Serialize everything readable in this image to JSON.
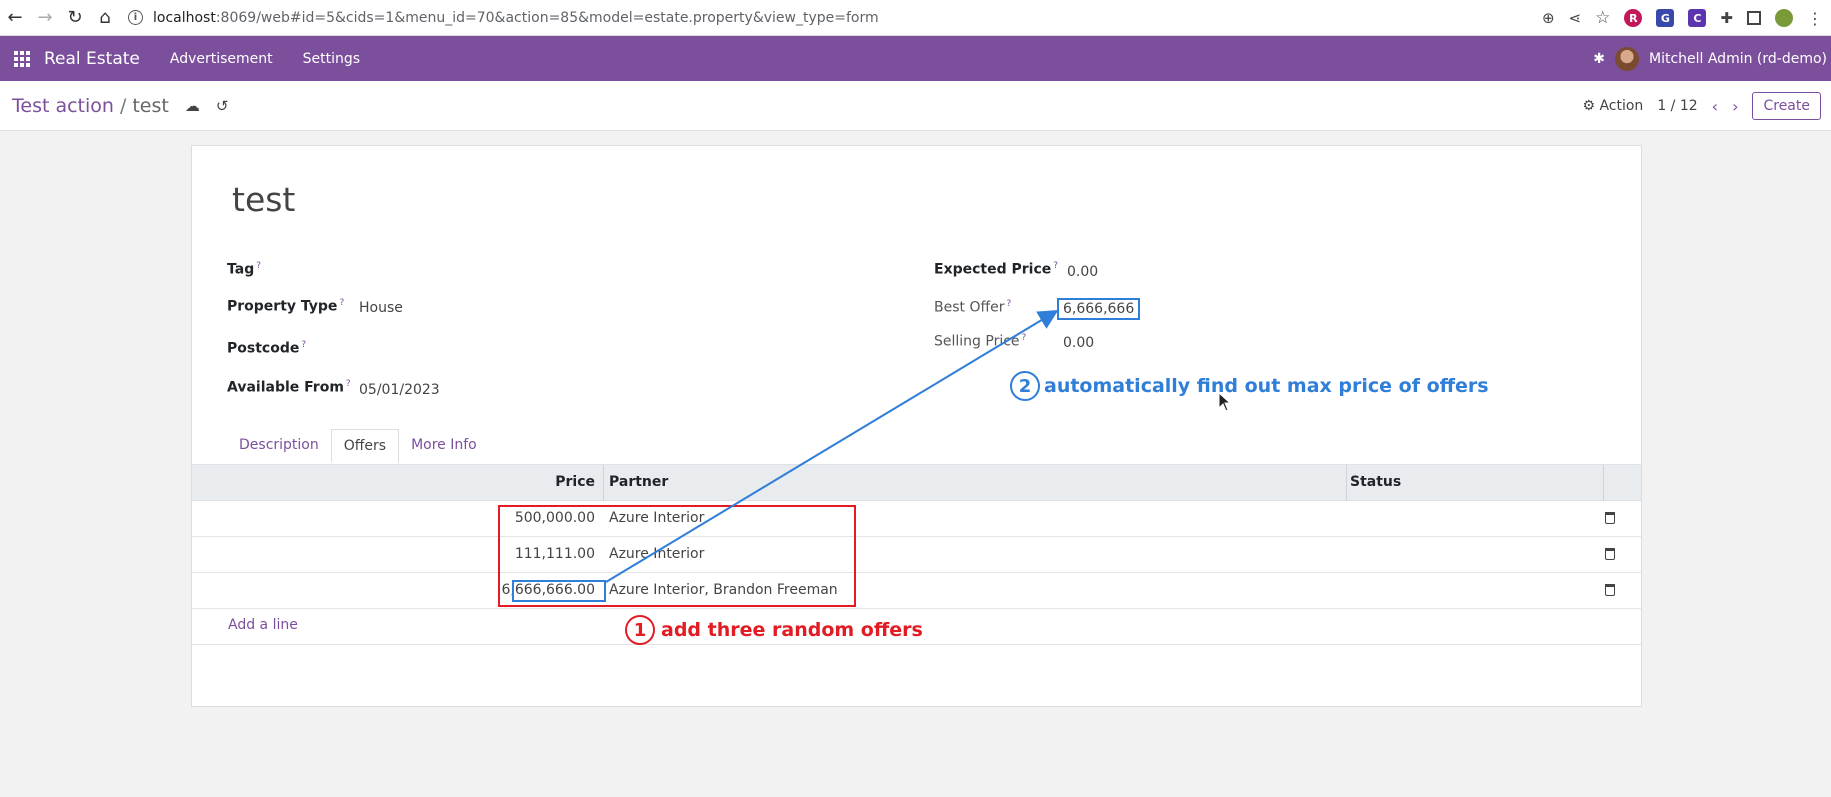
{
  "browser": {
    "url_host": "localhost",
    "url_rest": ":8069/web#id=5&cids=1&menu_id=70&action=85&model=estate.property&view_type=form"
  },
  "navbar": {
    "brand": "Real Estate",
    "menu": [
      "Advertisement",
      "Settings"
    ],
    "user": "Mitchell Admin (rd-demo)"
  },
  "control_panel": {
    "breadcrumb_parent": "Test action",
    "breadcrumb_sep": "/",
    "breadcrumb_current": "test",
    "action_label": "Action",
    "pager": "1 / 12",
    "create_label": "Create"
  },
  "record": {
    "title": "test",
    "left_fields": [
      {
        "label": "Tag",
        "value": ""
      },
      {
        "label": "Property Type",
        "value": "House"
      },
      {
        "label": "Postcode",
        "value": ""
      },
      {
        "label": "Available From",
        "value": "05/01/2023"
      }
    ],
    "right_fields": [
      {
        "label": "Expected Price",
        "value": "0.00"
      },
      {
        "label": "Best Offer",
        "value": "6,666,666"
      },
      {
        "label": "Selling Price",
        "value": "0.00"
      }
    ],
    "help_mark": "?"
  },
  "tabs": [
    "Description",
    "Offers",
    "More Info"
  ],
  "offers": {
    "headers": {
      "price": "Price",
      "partner": "Partner",
      "status": "Status"
    },
    "rows": [
      {
        "price": "500,000.00",
        "partner": "Azure Interior"
      },
      {
        "price": "111,111.00",
        "partner": "Azure Interior"
      },
      {
        "price": "6,666,666.00",
        "partner": "Azure Interior, Brandon Freeman"
      }
    ],
    "add_line": "Add a line"
  },
  "annotations": {
    "step1_num": "1",
    "step1_text": "add three random offers",
    "step2_num": "2",
    "step2_text": "automatically find out max price of offers",
    "red_color": "#e31b23",
    "blue_color": "#2f7ed8"
  },
  "colors": {
    "brand": "#7c4f9d"
  }
}
